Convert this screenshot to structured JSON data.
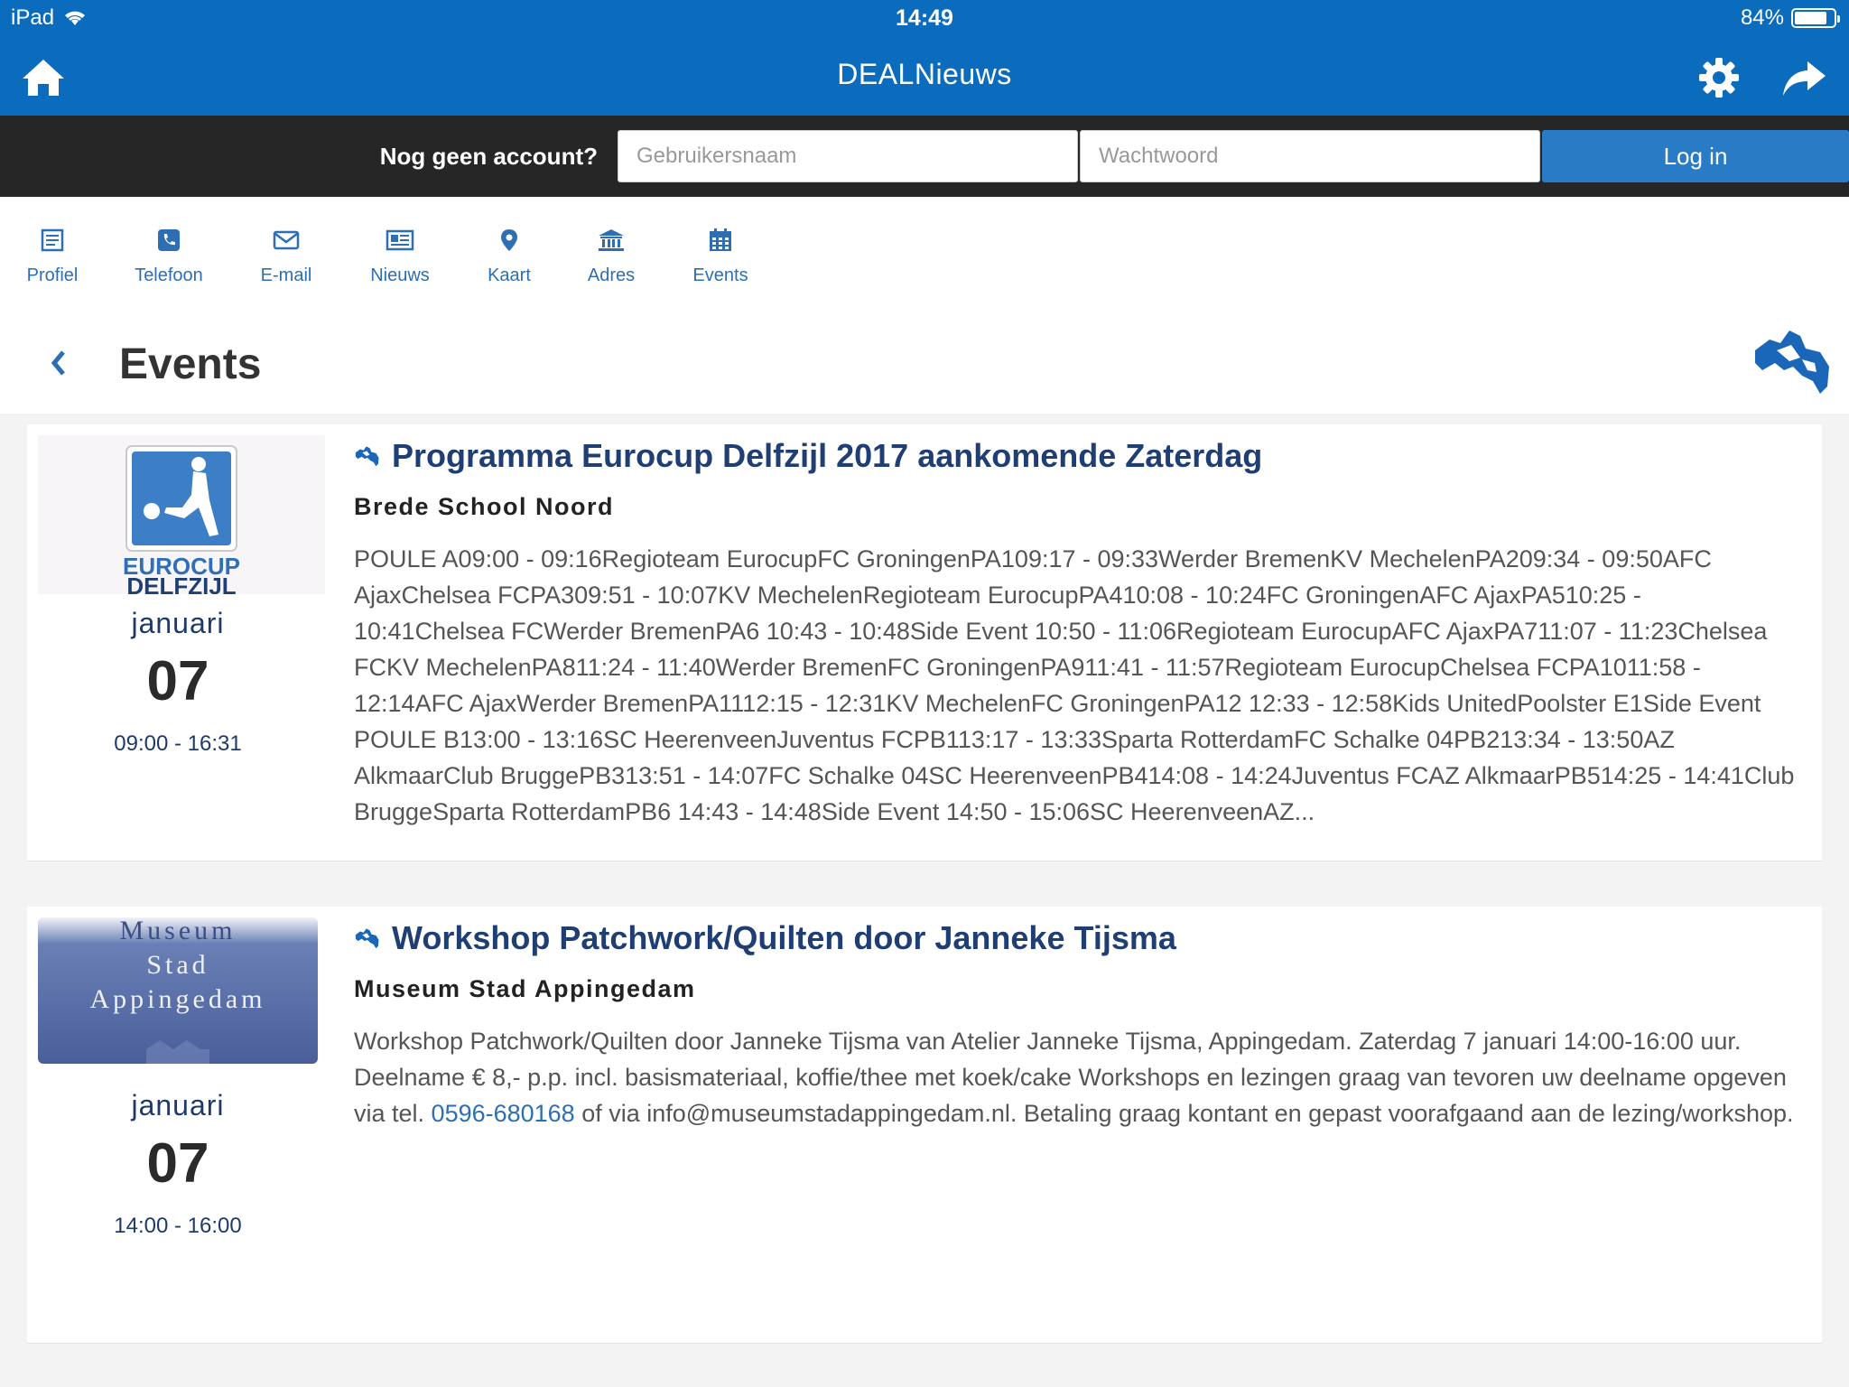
{
  "status": {
    "device": "iPad",
    "time": "14:49",
    "battery": "84%",
    "battery_level": 0.84
  },
  "nav": {
    "title": "DEALNieuws"
  },
  "login": {
    "prompt": "Nog geen account?",
    "username_placeholder": "Gebruikersnaam",
    "password_placeholder": "Wachtwoord",
    "button": "Log in"
  },
  "tabs": [
    {
      "label": "Profiel",
      "icon": "profile-icon"
    },
    {
      "label": "Telefoon",
      "icon": "phone-icon"
    },
    {
      "label": "E-mail",
      "icon": "mail-icon"
    },
    {
      "label": "Nieuws",
      "icon": "news-icon"
    },
    {
      "label": "Kaart",
      "icon": "map-pin-icon"
    },
    {
      "label": "Adres",
      "icon": "building-icon"
    },
    {
      "label": "Events",
      "icon": "calendar-icon"
    }
  ],
  "page": {
    "title": "Events"
  },
  "events": [
    {
      "logo_line1": "EUROCUP",
      "logo_line2": "DELFZIJL",
      "month": "januari",
      "day": "07",
      "hours": "09:00 - 16:31",
      "title": "Programma Eurocup Delfzijl 2017 aankomende Zaterdag",
      "venue": "Brede School Noord",
      "description": "POULE A09:00 - 09:16Regioteam EurocupFC GroningenPA109:17 - 09:33Werder BremenKV MechelenPA209:34 - 09:50AFC AjaxChelsea FCPA309:51 - 10:07KV MechelenRegioteam EurocupPA410:08 - 10:24FC GroningenAFC AjaxPA510:25 - 10:41Chelsea FCWerder BremenPA6 10:43 - 10:48Side Event 10:50 - 11:06Regioteam EurocupAFC AjaxPA711:07 - 11:23Chelsea FCKV MechelenPA811:24 - 11:40Werder BremenFC GroningenPA911:41 - 11:57Regioteam EurocupChelsea FCPA1011:58 - 12:14AFC AjaxWerder BremenPA1112:15 - 12:31KV MechelenFC GroningenPA12 12:33 - 12:58Kids UnitedPoolster E1Side Event POULE B13:00 - 13:16SC HeerenveenJuventus FCPB113:17 - 13:33Sparta RotterdamFC Schalke 04PB213:34 - 13:50AZ AlkmaarClub BruggePB313:51 - 14:07FC Schalke 04SC HeerenveenPB414:08 - 14:24Juventus FCAZ AlkmaarPB514:25 - 14:41Club BruggeSparta RotterdamPB6 14:43 - 14:48Side Event 14:50 - 15:06SC HeerenveenAZ..."
    },
    {
      "logo_line1": "Museum",
      "logo_line2": "Stad",
      "logo_line3": "Appingedam",
      "month": "januari",
      "day": "07",
      "hours": "14:00 - 16:00",
      "title": "Workshop Patchwork/Quilten door Janneke Tijsma",
      "venue": "Museum Stad Appingedam",
      "desc_part1": "Workshop Patchwork/Quilten door Janneke Tijsma van Atelier Janneke Tijsma, Appingedam. Zaterdag 7 januari 14:00-16:00 uur. Deelname € 8,- p.p. incl. basismateriaal, koffie/thee met koek/cake Workshops en lezingen graag van tevoren uw deelname opgeven via tel. ",
      "desc_phone": "0596-680168",
      "desc_part2": " of via info@museumstadappingedam.nl. Betaling graag kontant en gepast voorafgaand aan de lezing/workshop."
    }
  ],
  "colors": {
    "primary": "#0b6cbe",
    "dark_bar": "#262626",
    "accent": "#2d6fb2",
    "title": "#1f3e73"
  }
}
